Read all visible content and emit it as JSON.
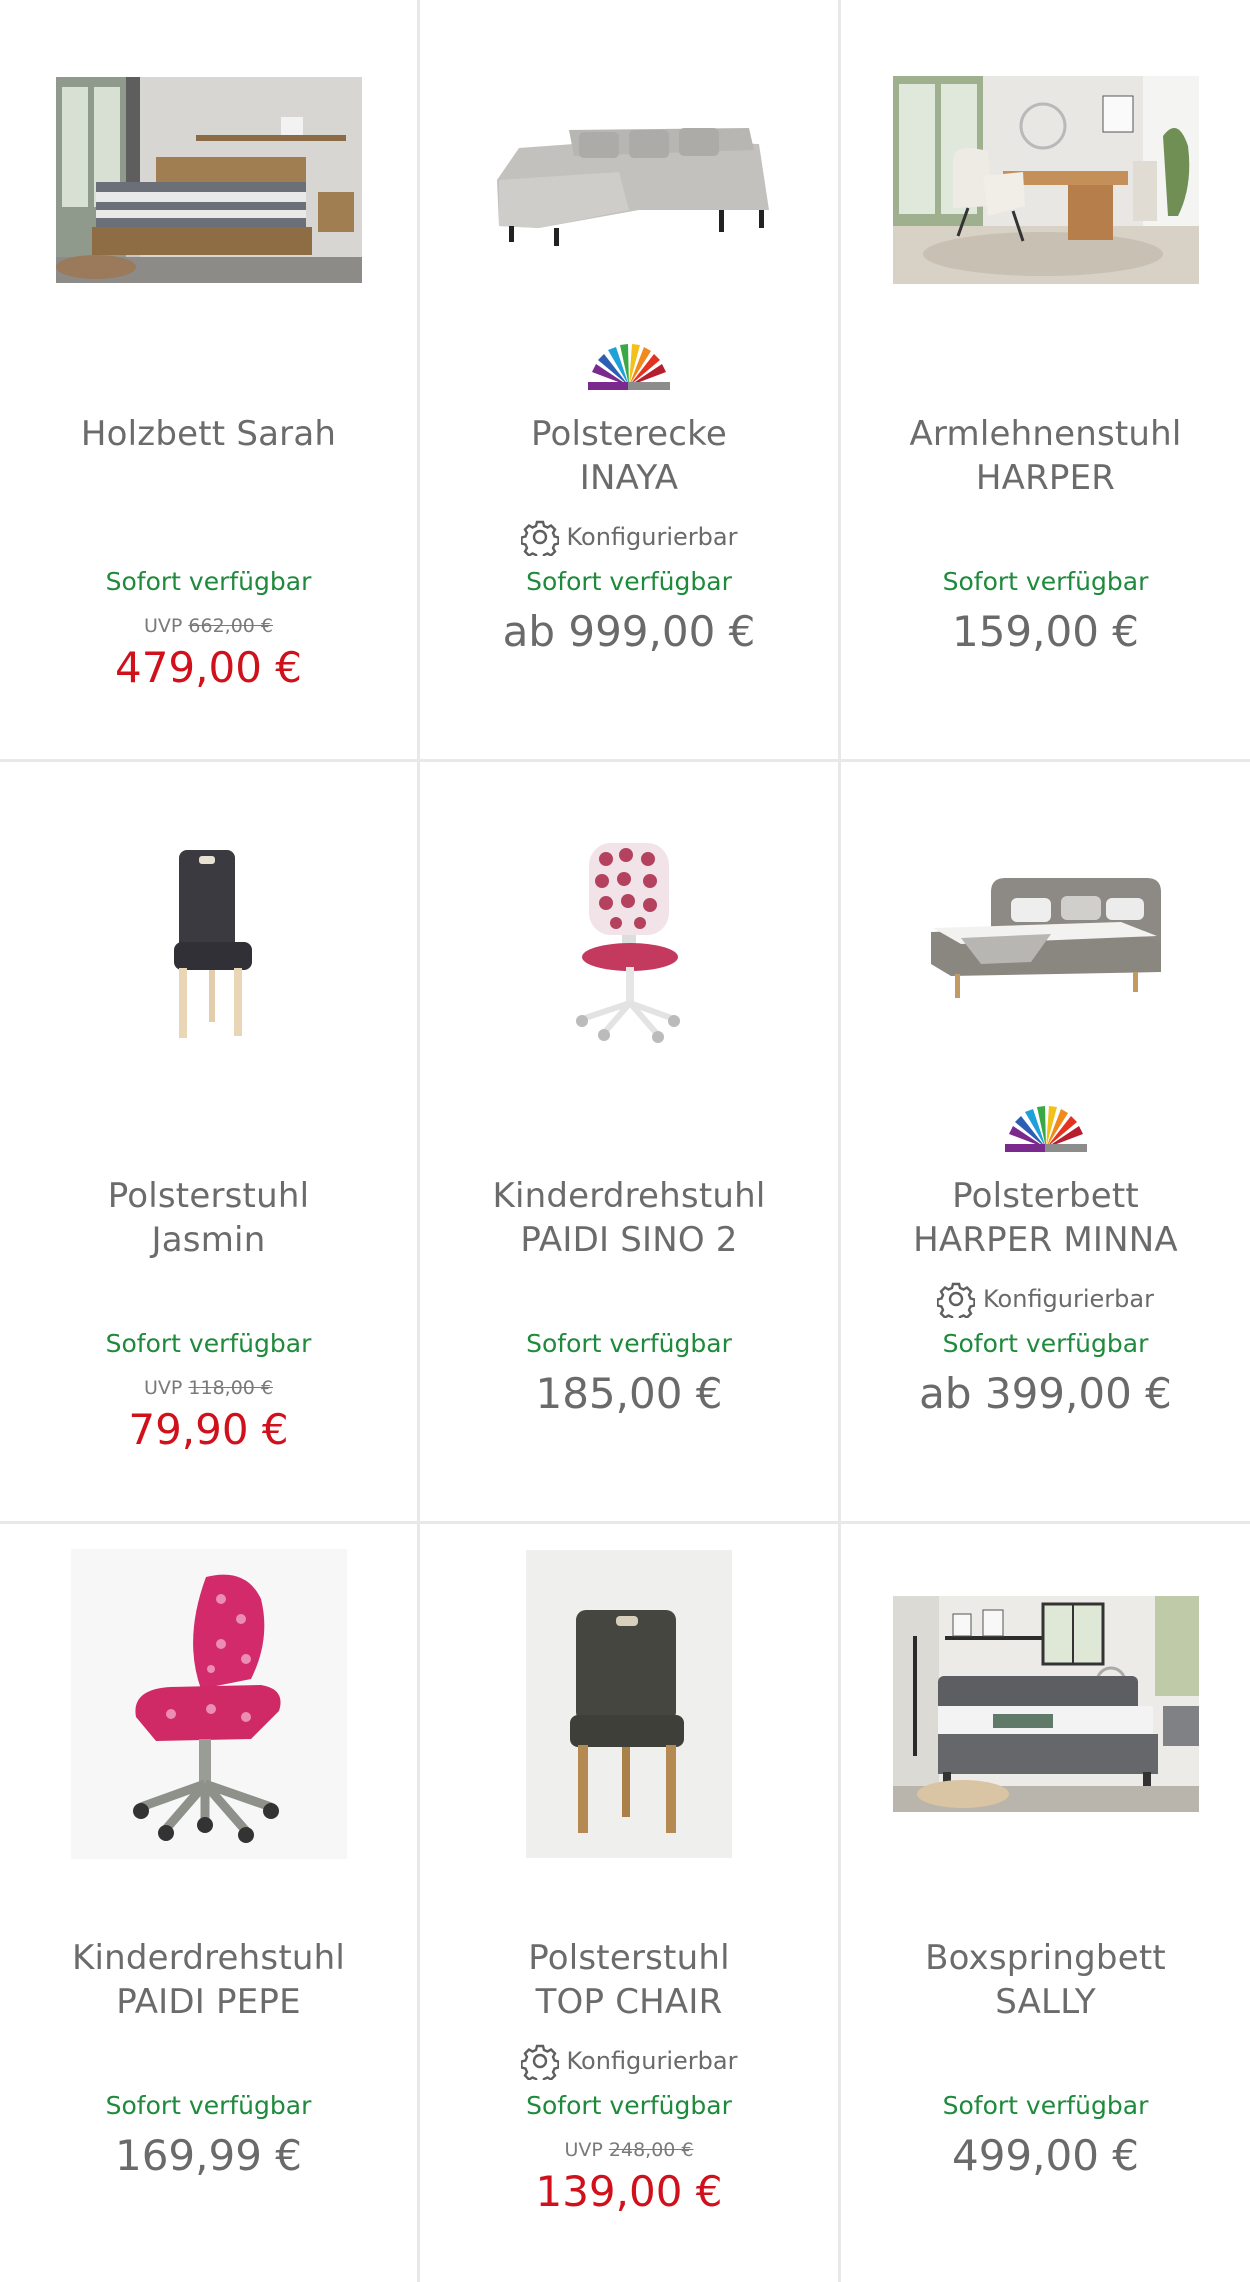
{
  "products": [
    {
      "name_lines": [
        "Holzbett Sarah"
      ],
      "image_icon": "bed-room-photo",
      "has_label": false,
      "configurable": false,
      "availability": "Sofort verfügbar",
      "uvp_label": "UVP",
      "uvp_price": "662,00 €",
      "price": "479,00 €",
      "sale": true
    },
    {
      "name_lines": [
        "Polsterecke",
        "INAYA"
      ],
      "image_icon": "corner-sofa-photo",
      "has_label": true,
      "configurable": true,
      "config_text": "Konfigurierbar",
      "availability": "Sofort verfügbar",
      "price": "ab 999,00 €",
      "sale": false
    },
    {
      "name_lines": [
        "Armlehnenstuhl",
        "HARPER"
      ],
      "image_icon": "dining-room-photo",
      "has_label": false,
      "configurable": false,
      "availability": "Sofort verfügbar",
      "price": "159,00 €",
      "sale": false
    },
    {
      "name_lines": [
        "Polsterstuhl",
        "Jasmin"
      ],
      "image_icon": "upholstered-chair-photo",
      "has_label": false,
      "configurable": false,
      "availability": "Sofort verfügbar",
      "uvp_label": "UVP",
      "uvp_price": "118,00 €",
      "price": "79,90 €",
      "sale": true
    },
    {
      "name_lines": [
        "Kinderdrehstuhl",
        "PAIDI SINO 2"
      ],
      "image_icon": "kids-swivel-chair-photo",
      "has_label": false,
      "configurable": false,
      "availability": "Sofort verfügbar",
      "price": "185,00 €",
      "sale": false
    },
    {
      "name_lines": [
        "Polsterbett",
        "HARPER MINNA"
      ],
      "image_icon": "upholstered-bed-photo",
      "has_label": true,
      "configurable": true,
      "config_text": "Konfigurierbar",
      "availability": "Sofort verfügbar",
      "price": "ab 399,00 €",
      "sale": false
    },
    {
      "name_lines": [
        "Kinderdrehstuhl",
        "PAIDI PEPE"
      ],
      "image_icon": "kids-chair-pink-photo",
      "has_label": false,
      "configurable": false,
      "availability": "Sofort verfügbar",
      "price": "169,99 €",
      "sale": false
    },
    {
      "name_lines": [
        "Polsterstuhl",
        "TOP CHAIR"
      ],
      "image_icon": "dark-chair-photo",
      "has_label": false,
      "configurable": true,
      "config_text": "Konfigurierbar",
      "availability": "Sofort verfügbar",
      "uvp_label": "UVP",
      "uvp_price": "248,00 €",
      "price": "139,00 €",
      "sale": true
    },
    {
      "name_lines": [
        "Boxspringbett",
        "SALLY"
      ],
      "image_icon": "boxspring-bedroom-photo",
      "has_label": false,
      "configurable": false,
      "availability": "Sofort verfügbar",
      "price": "499,00 €",
      "sale": false
    }
  ],
  "colors": {
    "available": "#1e8a3b",
    "sale_price": "#d0111b",
    "text": "#6a6a6a",
    "divider": "#e8e8e8"
  }
}
